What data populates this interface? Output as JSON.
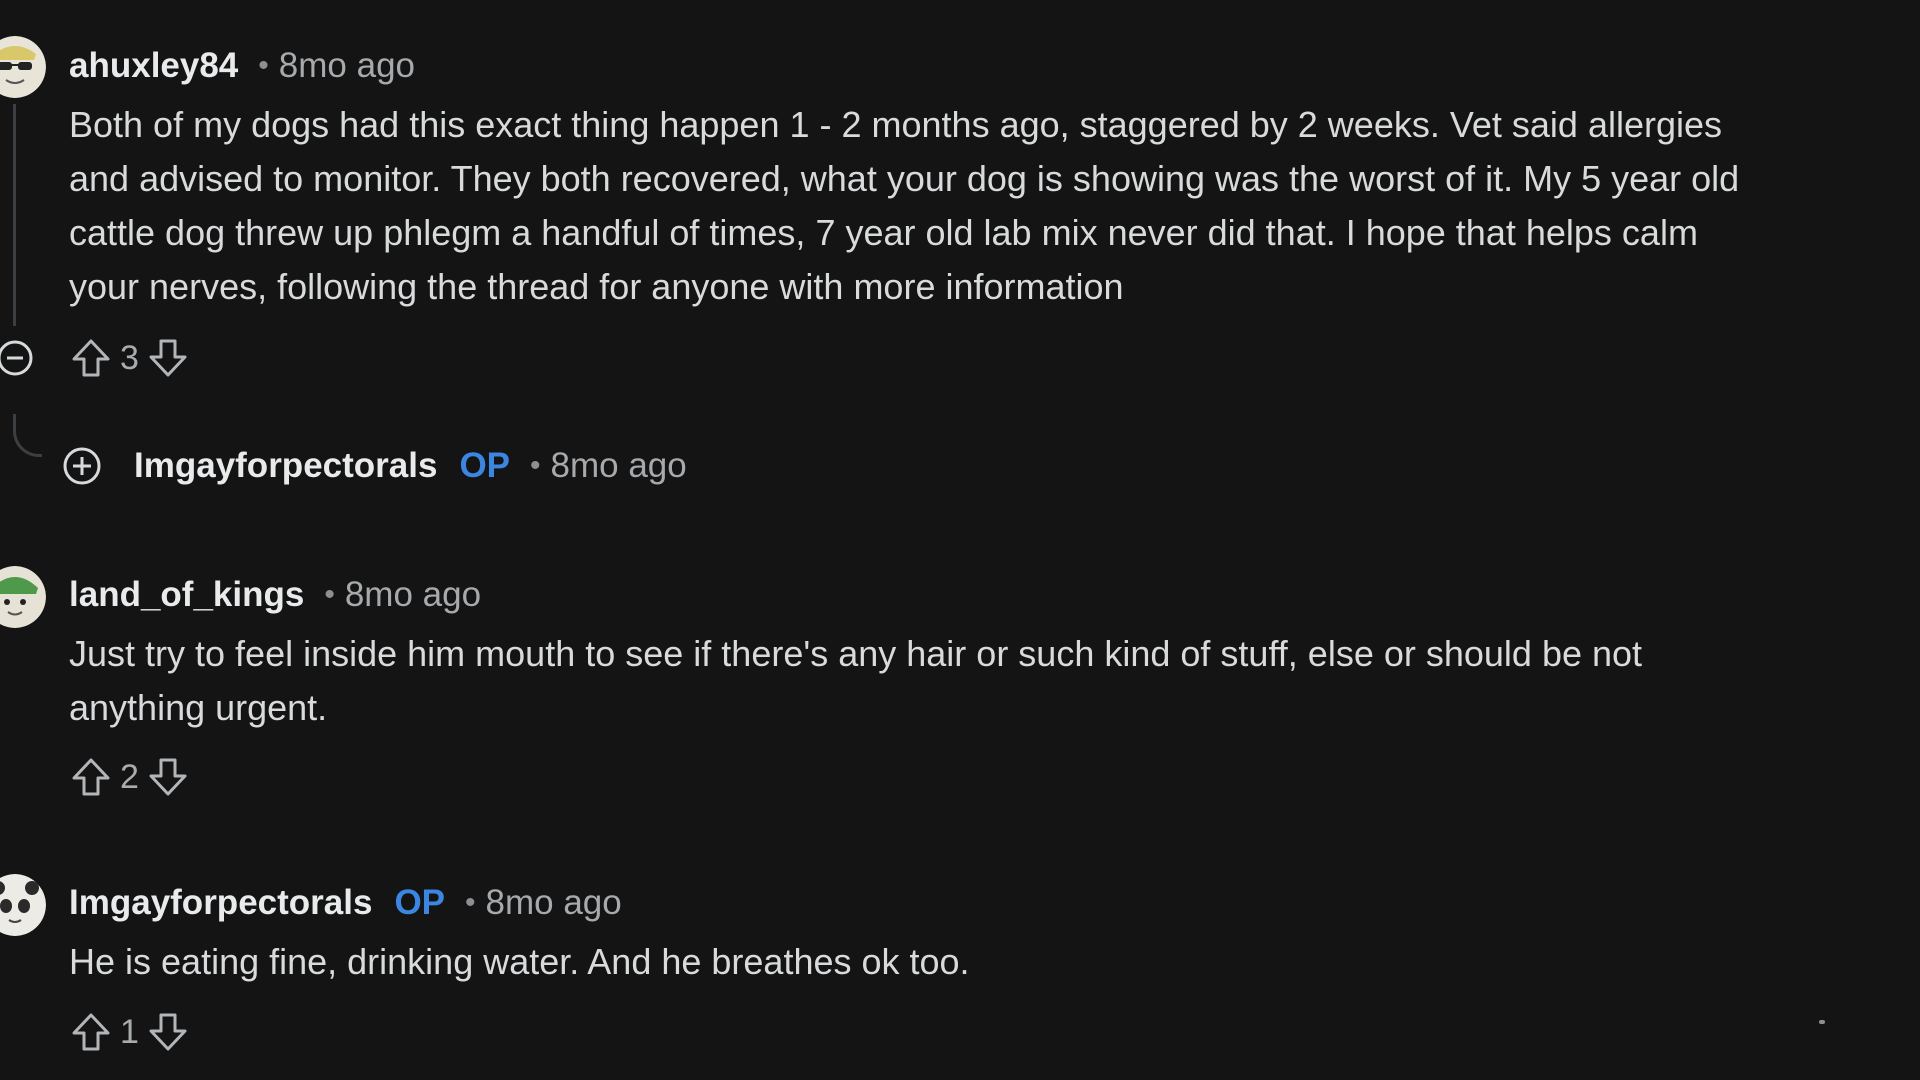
{
  "comments": [
    {
      "author": "ahuxley84",
      "op_badge": "",
      "time": "8mo ago",
      "lines": [
        "Both of my dogs had this exact thing happen 1 - 2 months ago, staggered by 2 weeks. Vet said allergies",
        "and advised to monitor. They both recovered, what your dog is showing was the worst of it. My 5 year old",
        "cattle dog threw up phlegm a handful of times, 7 year old lab mix never did that. I hope that helps calm",
        "your nerves, following the thread for anyone with more information"
      ],
      "score": "3",
      "avatar_icon": "avatar-sunglasses-icon"
    },
    {
      "author": "land_of_kings",
      "op_badge": "",
      "time": "8mo ago",
      "lines": [
        "Just try to feel inside him mouth to see if there's any hair or such kind of stuff, else or should be not",
        "anything urgent."
      ],
      "score": "2",
      "avatar_icon": "avatar-green-hat-icon"
    },
    {
      "author": "Imgayforpectorals",
      "op_badge": "OP",
      "time": "8mo ago",
      "lines": [
        "He is eating fine, drinking water. And he breathes ok too."
      ],
      "score": "1",
      "avatar_icon": "avatar-panda-icon"
    }
  ],
  "collapsed_reply": {
    "author": "Imgayforpectorals",
    "op_badge": "OP",
    "time": "8mo ago"
  },
  "separator": "•",
  "colors": {
    "background": "#141414",
    "text": "#d8dadb",
    "muted": "#a6aaad",
    "op_accent": "#3a86e0",
    "thread_line": "#3b3f42"
  },
  "icons": {
    "upvote": "arrow-up-outline-icon",
    "downvote": "arrow-down-outline-icon",
    "collapse": "circle-minus-icon",
    "expand": "circle-plus-icon"
  }
}
